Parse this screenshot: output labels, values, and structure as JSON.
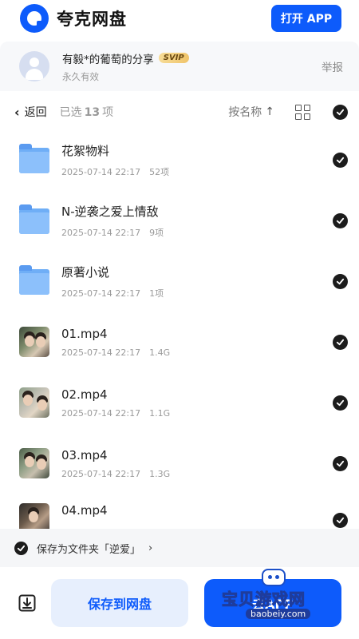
{
  "header": {
    "app_name": "夸克网盘",
    "open_app_label": "打开 APP",
    "logo_icon": "quark-logo"
  },
  "share": {
    "title": "有毅*的葡萄的分享",
    "badge": "SVIP",
    "validity": "永久有效",
    "report_label": "举报"
  },
  "toolbar": {
    "back_label": "返回",
    "selected_prefix": "已选",
    "selected_count": "13",
    "selected_suffix": "项",
    "sort_label": "按名称",
    "sort_arrow": "↑"
  },
  "files": [
    {
      "name": "花絮物料",
      "date": "2025-07-14 22:17",
      "size": "52项",
      "type": "folder",
      "selected": true
    },
    {
      "name": "N-逆袭之爱上情敌",
      "date": "2025-07-14 22:17",
      "size": "9项",
      "type": "folder",
      "selected": true
    },
    {
      "name": "原著小说",
      "date": "2025-07-14 22:17",
      "size": "1项",
      "type": "folder",
      "selected": true
    },
    {
      "name": "01.mp4",
      "date": "2025-07-14 22:17",
      "size": "1.4G",
      "type": "video",
      "selected": true
    },
    {
      "name": "02.mp4",
      "date": "2025-07-14 22:17",
      "size": "1.1G",
      "type": "video",
      "selected": true
    },
    {
      "name": "03.mp4",
      "date": "2025-07-14 22:17",
      "size": "1.3G",
      "type": "video",
      "selected": true
    },
    {
      "name": "04.mp4",
      "date": "",
      "size": "",
      "type": "video",
      "selected": true
    }
  ],
  "save_folder": {
    "label": "保存为文件夹「逆爱」",
    "chevron": "›"
  },
  "bottom": {
    "save_to_cloud_label": "保存到网盘",
    "primary_label": "去APP"
  },
  "watermark": {
    "text": "宝贝游戏网",
    "url": "baobeiy.com"
  },
  "colors": {
    "accent": "#0d5bfb",
    "check": "#1c1c1c",
    "folder": "#6faef6"
  }
}
